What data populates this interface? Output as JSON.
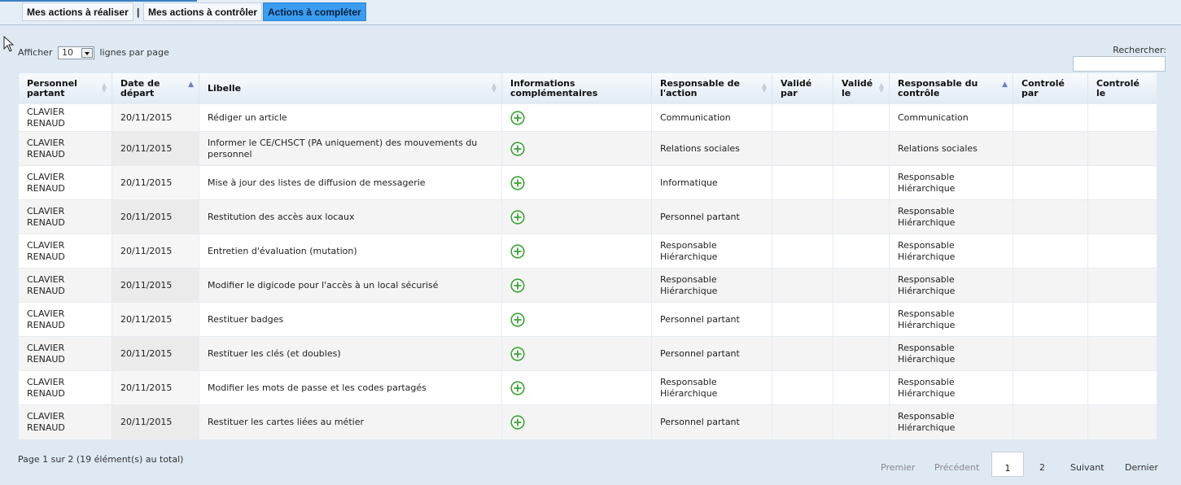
{
  "tabs": [
    {
      "label": "Mes actions à réaliser"
    },
    {
      "label": "Mes actions à contrôler"
    },
    {
      "label": "Actions à compléter"
    }
  ],
  "tab_separator": "|",
  "length": {
    "prefix": "Afficher",
    "value": "10",
    "suffix": "lignes par page"
  },
  "search": {
    "label": "Rechercher:",
    "value": ""
  },
  "columns": [
    "Personnel partant",
    "Date de départ",
    "Libelle",
    "Informations complémentaires",
    "Responsable de l'action",
    "Validé par",
    "Validé le",
    "Responsable du contrôle",
    "Controlé par",
    "Controlé le"
  ],
  "rows": [
    {
      "person": "CLAVIER RENAUD",
      "date": "20/11/2015",
      "libelle": "Rédiger un article",
      "resp_action": "Communication",
      "resp_controle": "Communication"
    },
    {
      "person": "CLAVIER RENAUD",
      "date": "20/11/2015",
      "libelle": "Informer le CE/CHSCT (PA uniquement) des mouvements du personnel",
      "resp_action": "Relations sociales",
      "resp_controle": "Relations sociales"
    },
    {
      "person": "CLAVIER RENAUD",
      "date": "20/11/2015",
      "libelle": "Mise à jour des listes de diffusion de messagerie",
      "resp_action": "Informatique",
      "resp_controle": "Responsable Hiérarchique"
    },
    {
      "person": "CLAVIER RENAUD",
      "date": "20/11/2015",
      "libelle": "Restitution des accès aux locaux",
      "resp_action": "Personnel partant",
      "resp_controle": "Responsable Hiérarchique"
    },
    {
      "person": "CLAVIER RENAUD",
      "date": "20/11/2015",
      "libelle": "Entretien d'évaluation (mutation)",
      "resp_action": "Responsable Hiérarchique",
      "resp_controle": "Responsable Hiérarchique"
    },
    {
      "person": "CLAVIER RENAUD",
      "date": "20/11/2015",
      "libelle": "Modifier le digicode pour l'accès à un local sécurisé",
      "resp_action": "Responsable Hiérarchique",
      "resp_controle": "Responsable Hiérarchique"
    },
    {
      "person": "CLAVIER RENAUD",
      "date": "20/11/2015",
      "libelle": "Restituer badges",
      "resp_action": "Personnel partant",
      "resp_controle": "Responsable Hiérarchique"
    },
    {
      "person": "CLAVIER RENAUD",
      "date": "20/11/2015",
      "libelle": "Restituer les clés (et doubles)",
      "resp_action": "Personnel partant",
      "resp_controle": "Responsable Hiérarchique"
    },
    {
      "person": "CLAVIER RENAUD",
      "date": "20/11/2015",
      "libelle": "Modifier les mots de passe et les codes partagés",
      "resp_action": "Responsable Hiérarchique",
      "resp_controle": "Responsable Hiérarchique"
    },
    {
      "person": "CLAVIER RENAUD",
      "date": "20/11/2015",
      "libelle": "Restituer les cartes liées au métier",
      "resp_action": "Personnel partant",
      "resp_controle": "Responsable Hiérarchique"
    }
  ],
  "info_icon": "plus-circle-icon",
  "info_icon_color": "#3aa335",
  "page_info": "Page 1 sur 2 (19 élément(s) au total)",
  "pagination": {
    "first": "Premier",
    "previous": "Précédent",
    "page1": "1",
    "page2": "2",
    "next": "Suivant",
    "last": "Dernier"
  },
  "colors": {
    "active_tab": "#3b9cf0",
    "background": "#dfe9f4",
    "sort_active": "#6f7ec8"
  }
}
